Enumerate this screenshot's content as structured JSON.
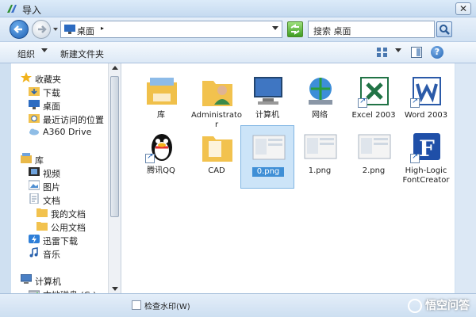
{
  "window": {
    "title": "导入",
    "close_label": "✕"
  },
  "address_bar": {
    "location": "桌面",
    "chevron": "▸",
    "search_placeholder": "搜索 桌面"
  },
  "toolbar": {
    "organize": "组织",
    "new_folder": "新建文件夹",
    "help": "?"
  },
  "nav_pane": {
    "items": [
      {
        "label": "收藏夹",
        "icon": "star-icon"
      },
      {
        "label": "下载",
        "icon": "download-folder-icon"
      },
      {
        "label": "桌面",
        "icon": "desktop-icon"
      },
      {
        "label": "最近访问的位置",
        "icon": "recent-places-icon"
      },
      {
        "label": "A360 Drive",
        "icon": "cloud-drive-icon"
      },
      {
        "label": "库",
        "icon": "library-icon"
      },
      {
        "label": "视频",
        "icon": "video-library-icon"
      },
      {
        "label": "图片",
        "icon": "pictures-library-icon"
      },
      {
        "label": "文档",
        "icon": "documents-library-icon"
      },
      {
        "label": "我的文档",
        "icon": "folder-icon"
      },
      {
        "label": "公用文档",
        "icon": "folder-icon"
      },
      {
        "label": "迅雷下载",
        "icon": "thunder-download-icon"
      },
      {
        "label": "音乐",
        "icon": "music-library-icon"
      },
      {
        "label": "计算机",
        "icon": "computer-icon"
      },
      {
        "label": "本地磁盘 (C:)",
        "icon": "hard-drive-icon"
      }
    ]
  },
  "files": [
    {
      "name": "库",
      "icon": "library-folder-icon",
      "shortcut": false
    },
    {
      "name": "Administrator",
      "icon": "user-folder-icon",
      "shortcut": false
    },
    {
      "name": "计算机",
      "icon": "computer-icon",
      "shortcut": false
    },
    {
      "name": "网络",
      "icon": "network-icon",
      "shortcut": false
    },
    {
      "name": "Excel 2003",
      "icon": "excel-icon",
      "shortcut": true
    },
    {
      "name": "Word 2003",
      "icon": "word-icon",
      "shortcut": true
    },
    {
      "name": "腾讯QQ",
      "icon": "qq-penguin-icon",
      "shortcut": true
    },
    {
      "name": "CAD",
      "icon": "folder-icon",
      "shortcut": false
    },
    {
      "name": "0.png",
      "icon": "image-thumbnail-icon",
      "shortcut": false,
      "selected": true
    },
    {
      "name": "1.png",
      "icon": "image-thumbnail-icon",
      "shortcut": false
    },
    {
      "name": "2.png",
      "icon": "image-thumbnail-icon",
      "shortcut": false
    },
    {
      "name": "High-Logic FontCreator",
      "icon": "fontcreator-icon",
      "shortcut": true
    }
  ],
  "footer": {
    "checkbox_label": "检查水印(W)",
    "watermark_text": "悟空问答"
  },
  "colors": {
    "selection": "#3f8fd6",
    "selection_bg": "#cce4f8",
    "chrome": "#cfe0f1"
  }
}
